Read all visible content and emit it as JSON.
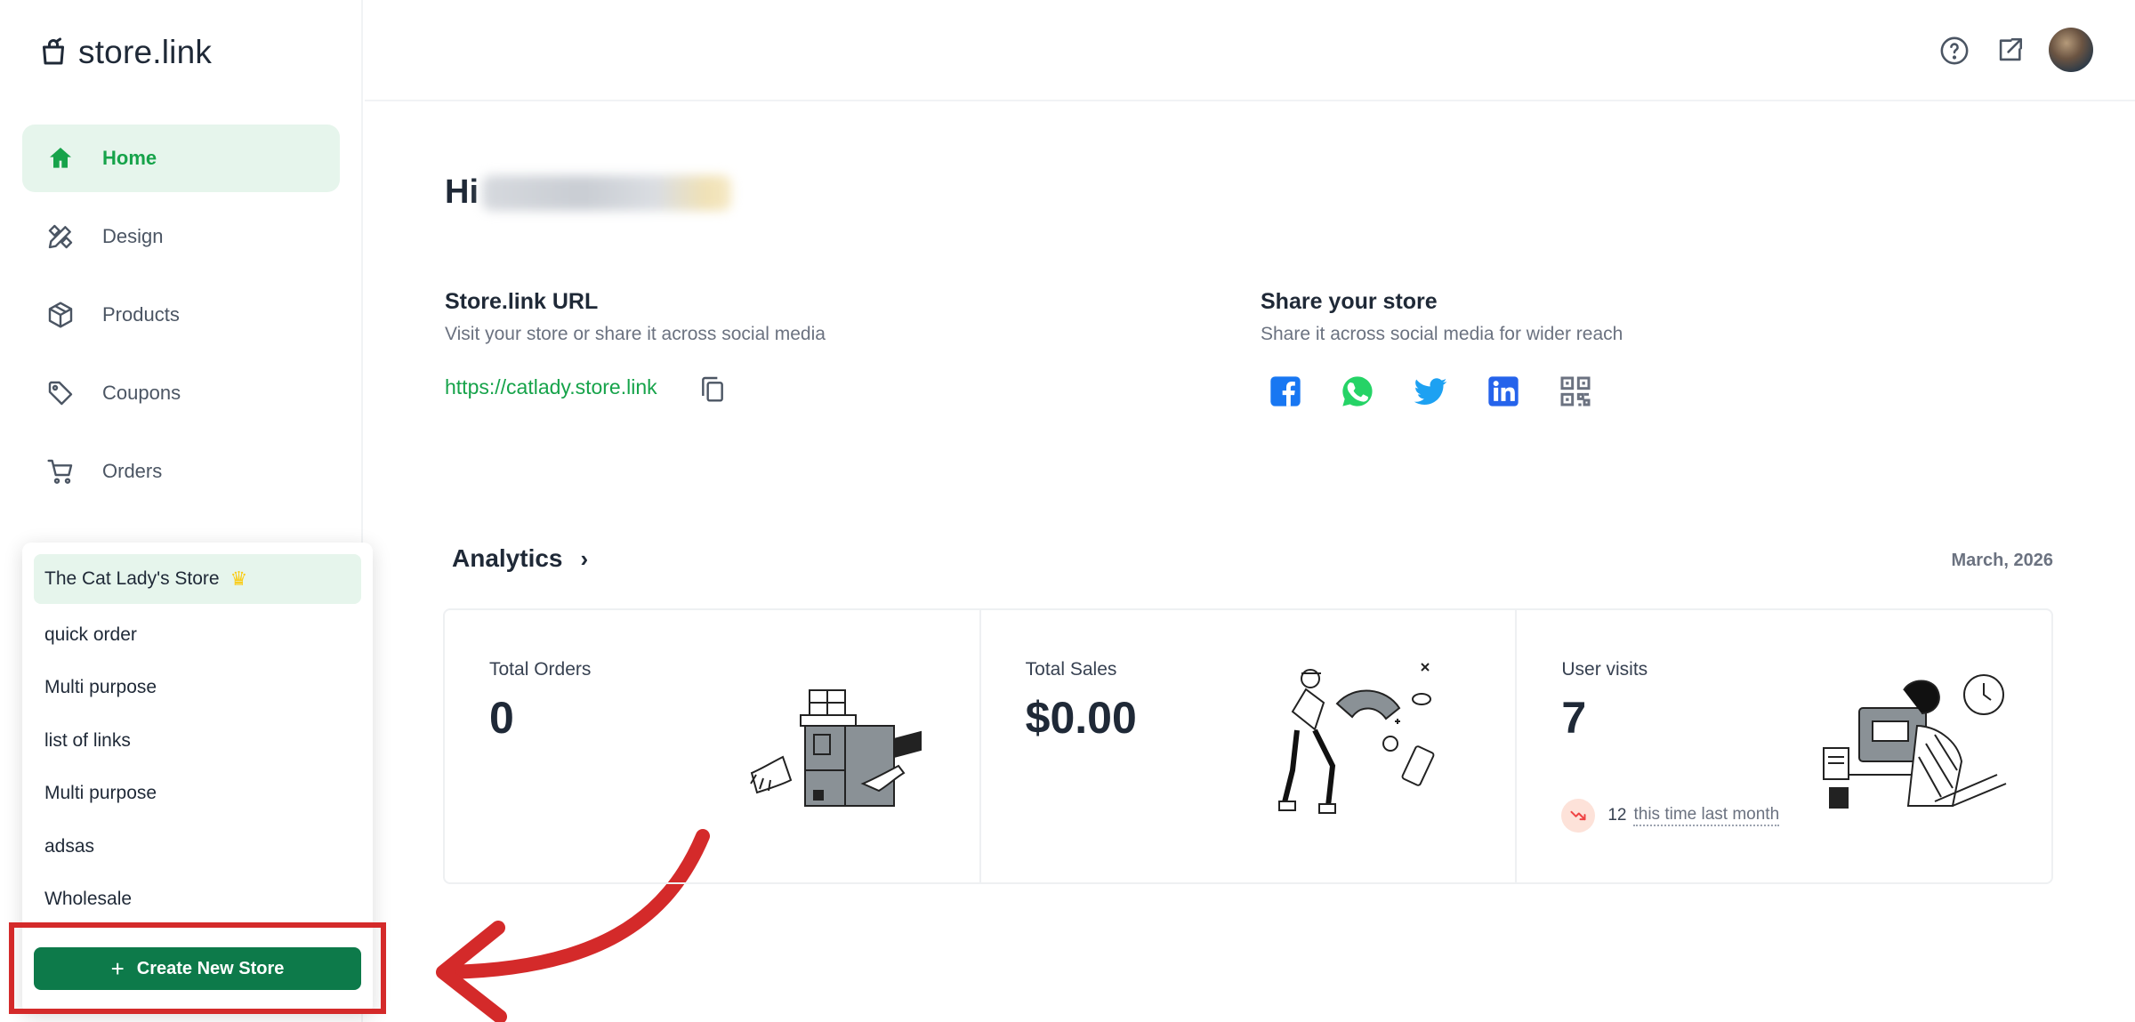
{
  "brand": {
    "name": "store.link"
  },
  "nav": {
    "items": [
      {
        "label": "Home",
        "icon": "home-icon",
        "active": true
      },
      {
        "label": "Design",
        "icon": "design-tools-icon"
      },
      {
        "label": "Products",
        "icon": "box-icon"
      },
      {
        "label": "Coupons",
        "icon": "tag-icon"
      },
      {
        "label": "Orders",
        "icon": "cart-icon"
      }
    ]
  },
  "store_switcher": {
    "stores": [
      {
        "name": "The Cat Lady's Store",
        "active": true,
        "badge": "crown-icon"
      },
      {
        "name": "quick order"
      },
      {
        "name": "Multi purpose"
      },
      {
        "name": "list of links"
      },
      {
        "name": "Multi purpose"
      },
      {
        "name": "adsas"
      },
      {
        "name": "Wholesale"
      }
    ],
    "create_label": "Create New Store"
  },
  "header": {
    "icons": [
      "help-icon",
      "external-link-icon",
      "avatar"
    ]
  },
  "greeting": {
    "prefix": "Hi"
  },
  "store_url": {
    "title": "Store.link URL",
    "subtitle": "Visit your store or share it across social media",
    "url": "https://catlady.store.link"
  },
  "share": {
    "title": "Share your store",
    "subtitle": "Share it across social media for wider reach",
    "networks": [
      "facebook-icon",
      "whatsapp-icon",
      "twitter-icon",
      "linkedin-icon",
      "qr-code-icon"
    ]
  },
  "analytics": {
    "title": "Analytics",
    "period": "March, 2026",
    "cards": [
      {
        "label": "Total Orders",
        "value": "0"
      },
      {
        "label": "Total Sales",
        "value": "$0.00"
      },
      {
        "label": "User visits",
        "value": "7",
        "trend_value": "12",
        "trend_text": "this time last month"
      }
    ]
  },
  "colors": {
    "accent": "#16a34a",
    "accent_bg": "#e6f5ec",
    "button": "#0d7a4a",
    "annotation": "#d42a2a"
  }
}
